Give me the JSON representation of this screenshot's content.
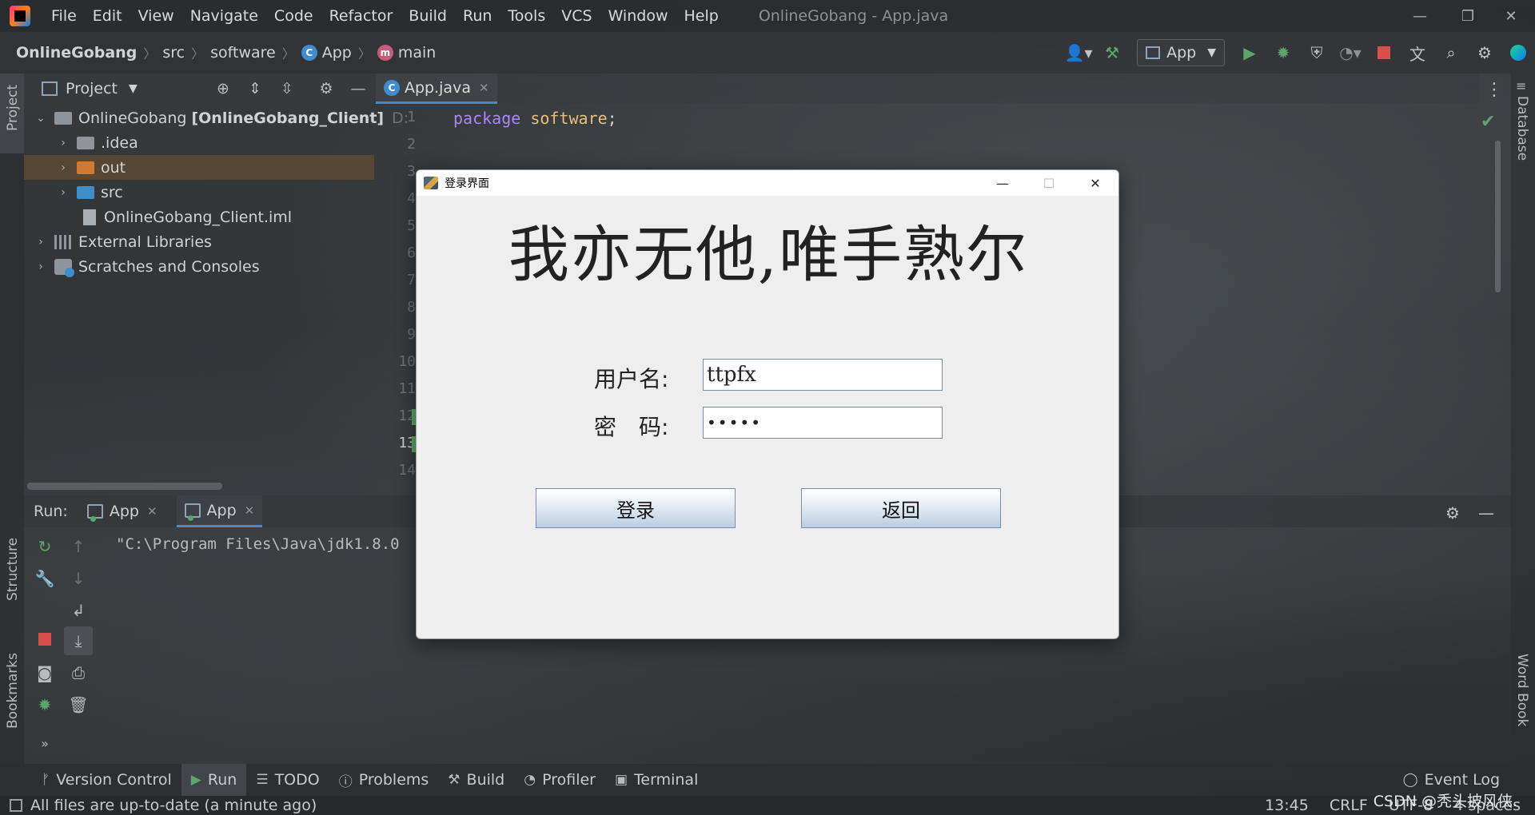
{
  "menubar": {
    "items": [
      "File",
      "Edit",
      "View",
      "Navigate",
      "Code",
      "Refactor",
      "Build",
      "Run",
      "Tools",
      "VCS",
      "Window",
      "Help"
    ],
    "window_title": "OnlineGobang - App.java",
    "controls": {
      "minimize": "—",
      "restore": "❐",
      "close": "✕"
    }
  },
  "breadcrumb": {
    "project": "OnlineGobang",
    "src": "src",
    "package": "software",
    "class": "App",
    "method": "main"
  },
  "toolbar": {
    "run_config": "App",
    "icons": [
      "user-icon",
      "build-hammer-icon",
      "run-icon",
      "debug-icon",
      "coverage-icon",
      "profile-icon",
      "stop-icon",
      "translate-icon",
      "search-icon",
      "settings-icon",
      "plugin-icon"
    ]
  },
  "left_stripe": {
    "project": "Project",
    "structure": "Structure",
    "bookmarks": "Bookmarks"
  },
  "right_stripe": {
    "database": "Database",
    "word_book": "Word Book"
  },
  "project_panel": {
    "title": "Project",
    "tree": [
      {
        "label": "OnlineGobang",
        "module": "[OnlineGobang_Client]",
        "suffix": "D:"
      },
      {
        "label": ".idea"
      },
      {
        "label": "out"
      },
      {
        "label": "src"
      },
      {
        "label": "OnlineGobang_Client.iml"
      },
      {
        "label": "External Libraries"
      },
      {
        "label": "Scratches and Consoles"
      }
    ]
  },
  "editor": {
    "tab": "App.java",
    "line_numbers": [
      "1",
      "2",
      "3",
      "4",
      "5",
      "6",
      "7",
      "8",
      "9",
      "10",
      "11",
      "12",
      "13",
      "14"
    ],
    "code_line1": {
      "keyword": "package",
      "name": "software",
      "end": ";"
    }
  },
  "run_panel": {
    "label": "Run:",
    "tabs": [
      "App",
      "App"
    ],
    "console_output": "\"C:\\Program Files\\Java\\jdk1.8.0"
  },
  "bottom_strip": {
    "items": [
      "Version Control",
      "Run",
      "TODO",
      "Problems",
      "Build",
      "Profiler",
      "Terminal"
    ],
    "event_log": "Event Log"
  },
  "statusbar": {
    "message": "All files are up-to-date (a minute ago)",
    "position": "13:45",
    "line_sep": "CRLF",
    "encoding": "UTF-8",
    "indent": "4 spaces"
  },
  "watermark": "CSDN @秃头披风侠.",
  "dialog": {
    "title": "登录界面",
    "heading": "我亦无他,唯手熟尔",
    "username_label": "用户名:",
    "username_value": "ttpfx",
    "password_label": "密　码:",
    "password_value": "•••••",
    "login_button": "登录",
    "back_button": "返回"
  }
}
